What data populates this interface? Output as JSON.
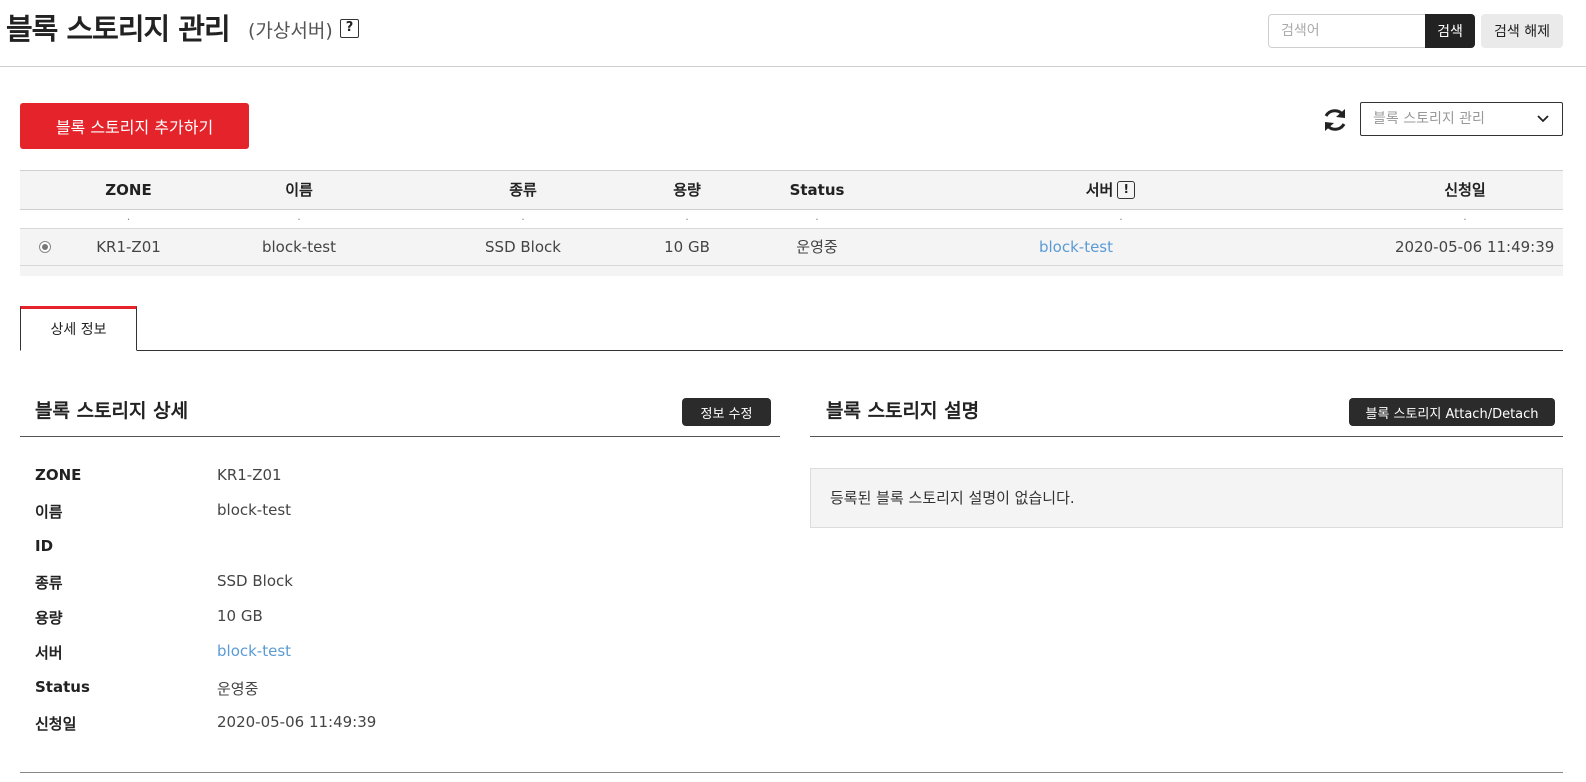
{
  "header": {
    "title": "블록 스토리지 관리",
    "subtitle": "(가상서버)",
    "help_label": "?",
    "search": {
      "placeholder": "검색어",
      "value": ""
    },
    "search_button": "검색",
    "search_reset_button": "검색 해제"
  },
  "toolbar": {
    "add_button": "블록 스토리지 추가하기",
    "view_select": "블록 스토리지 관리"
  },
  "table": {
    "columns": [
      "ZONE",
      "이름",
      "종류",
      "용량",
      "Status",
      "서버",
      "신청일"
    ],
    "server_info_icon": "!",
    "filter_placeholder": ".",
    "rows": [
      {
        "zone": "KR1-Z01",
        "name": "block-test",
        "type": "SSD Block",
        "size": "10 GB",
        "status": "운영중",
        "server": "block-test",
        "date": "2020-05-06 11:49:39",
        "selected": true
      }
    ]
  },
  "tabs": [
    {
      "label": "상세 정보",
      "active": true
    }
  ],
  "detail": {
    "title": "블록 스토리지 상세",
    "edit_button": "정보 수정",
    "fields": [
      {
        "label": "ZONE",
        "value": "KR1-Z01"
      },
      {
        "label": "이름",
        "value": "block-test"
      },
      {
        "label": "ID",
        "value": ""
      },
      {
        "label": "종류",
        "value": "SSD Block"
      },
      {
        "label": "용량",
        "value": "10 GB"
      },
      {
        "label": "서버",
        "value": "block-test"
      },
      {
        "label": "Status",
        "value": "운영중"
      },
      {
        "label": "신청일",
        "value": "2020-05-06 11:49:39"
      }
    ]
  },
  "description": {
    "title": "블록 스토리지 설명",
    "attach_button": "블록 스토리지 Attach/Detach",
    "empty_text": "등록된 블록 스토리지 설명이 없습니다."
  },
  "icons": {
    "help": "help-icon",
    "refresh": "refresh-icon",
    "dropdown": "chevron-down-icon",
    "info": "warning-icon"
  },
  "colors": {
    "accent": "#e5232a",
    "link": "#5b9bd5",
    "dark_button": "#2b2b2b"
  }
}
